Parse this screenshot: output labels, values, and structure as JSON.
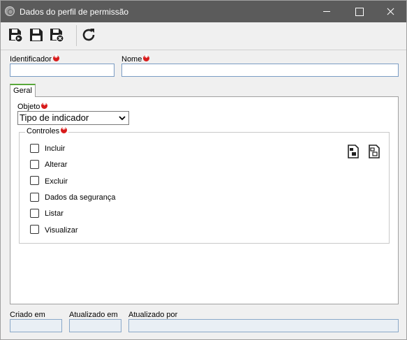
{
  "window": {
    "title": "Dados do perfil de permissão"
  },
  "toolbar": {
    "buttons": [
      {
        "icon": "save-new-icon"
      },
      {
        "icon": "save-icon"
      },
      {
        "icon": "save-close-icon"
      },
      {
        "icon": "refresh-icon"
      }
    ]
  },
  "form": {
    "identificador_label": "Identificador",
    "identificador_value": "",
    "nome_label": "Nome",
    "nome_value": "",
    "tab_label": "Geral",
    "objeto_label": "Objeto",
    "objeto_value": "Tipo de indicador",
    "controles_label": "Controles",
    "controles": [
      {
        "label": "Incluir",
        "checked": false
      },
      {
        "label": "Alterar",
        "checked": false
      },
      {
        "label": "Excluir",
        "checked": false
      },
      {
        "label": "Dados da segurança",
        "checked": false
      },
      {
        "label": "Listar",
        "checked": false
      },
      {
        "label": "Visualizar",
        "checked": false
      }
    ]
  },
  "footer": {
    "criado_em_label": "Criado em",
    "criado_em_value": "",
    "atualizado_em_label": "Atualizado em",
    "atualizado_em_value": "",
    "atualizado_por_label": "Atualizado por",
    "atualizado_por_value": ""
  },
  "colors": {
    "titlebar": "#5b5b5b",
    "required": "#d81c1c",
    "tab_accent": "#58a83a",
    "input_border": "#7a9cc4"
  }
}
